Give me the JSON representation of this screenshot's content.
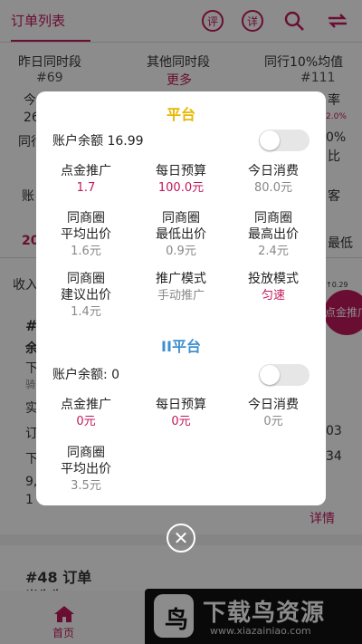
{
  "bg": {
    "tab_label": "订单列表",
    "icons": [
      "评",
      "详"
    ],
    "stats": [
      {
        "head": "昨日同时段",
        "val": "#69"
      },
      {
        "head": "其他同时段",
        "val": "更多"
      },
      {
        "head": "同行10%均值",
        "val": "#111"
      }
    ],
    "frag_today": "今",
    "frag_26": "26",
    "frag_same": "同行",
    "frag_rate": "率",
    "frag_pct": "2.0%",
    "frag_0pct": "0%",
    "frag_bi": "比",
    "frag_acct": "账",
    "frag_ke": "客",
    "frag_20": "20",
    "frag_zuidi": "最低",
    "frag_income": "收入",
    "frag_hash": "#",
    "frag_yu": "余",
    "frag_xia": "下",
    "frag_qi": "骑",
    "frag_shi": "实",
    "frag_ding": "订",
    "frag_xia2": "下",
    "frag_9": "9,",
    "frag_1": "1",
    "frag_03": "03",
    "frag_34": "34",
    "frag_dot": "↑0.29",
    "btn_label": "点金推广",
    "detail": "详情",
    "order48": "#48 订单",
    "order48_sub": "肖先生",
    "home": "首页"
  },
  "watermark": {
    "title": "下载鸟资源",
    "url": "www.xiazainiao.com",
    "logo_char": "鸟"
  },
  "modal": {
    "section1": {
      "title": "平台",
      "title_color": "#e6b800",
      "balance": "账户余额 16.99",
      "toggle_on": false,
      "cells": [
        {
          "label": [
            "点金推广"
          ],
          "value": "1.7",
          "value_color": "pink"
        },
        {
          "label": [
            "每日预算"
          ],
          "value": "100.0元",
          "value_color": "pink"
        },
        {
          "label": [
            "今日消费"
          ],
          "value": "80.0元",
          "value_color": "gray"
        },
        {
          "label": [
            "同商圈",
            "平均出价"
          ],
          "value": "1.6元",
          "value_color": "gray"
        },
        {
          "label": [
            "同商圈",
            "最低出价"
          ],
          "value": "0.9元",
          "value_color": "gray"
        },
        {
          "label": [
            "同商圈",
            "最高出价"
          ],
          "value": "2.4元",
          "value_color": "gray"
        },
        {
          "label": [
            "同商圈",
            "建议出价"
          ],
          "value": "1.4元",
          "value_color": "gray"
        },
        {
          "label": [
            "推广模式"
          ],
          "value": "手动推广",
          "value_color": "gray"
        },
        {
          "label": [
            "投放模式"
          ],
          "value": "匀速",
          "value_color": "pink"
        }
      ]
    },
    "section2": {
      "title": "II平台",
      "title_color": "#3d8fd1",
      "balance": "账户余额: 0",
      "toggle_on": false,
      "cells": [
        {
          "label": [
            "点金推广"
          ],
          "value": "0元",
          "value_color": "pink"
        },
        {
          "label": [
            "每日预算"
          ],
          "value": "0元",
          "value_color": "pink"
        },
        {
          "label": [
            "今日消费"
          ],
          "value": "0元",
          "value_color": "gray"
        },
        {
          "label": [
            "同商圈",
            "平均出价"
          ],
          "value": "3.5元",
          "value_color": "gray"
        }
      ]
    }
  }
}
